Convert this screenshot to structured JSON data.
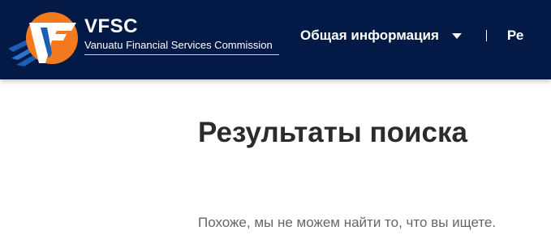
{
  "header": {
    "logo": {
      "abbr": "VFSC",
      "full_name": "Vanuatu Financial Services Commission"
    },
    "nav": {
      "items": [
        {
          "label": "Общая информация",
          "has_dropdown": true
        },
        {
          "label": "Ре"
        }
      ]
    }
  },
  "main": {
    "title": "Результаты поиска",
    "message": "Похоже, мы не можем найти то, что вы ищете."
  },
  "colors": {
    "header_bg": "#021a45",
    "logo_orange": "#f47a20",
    "logo_blue": "#1b5fb5",
    "title_text": "#2b2b2b",
    "body_text": "#666666"
  },
  "icons": [
    "vfsc-logo-icon",
    "chevron-down-icon"
  ]
}
